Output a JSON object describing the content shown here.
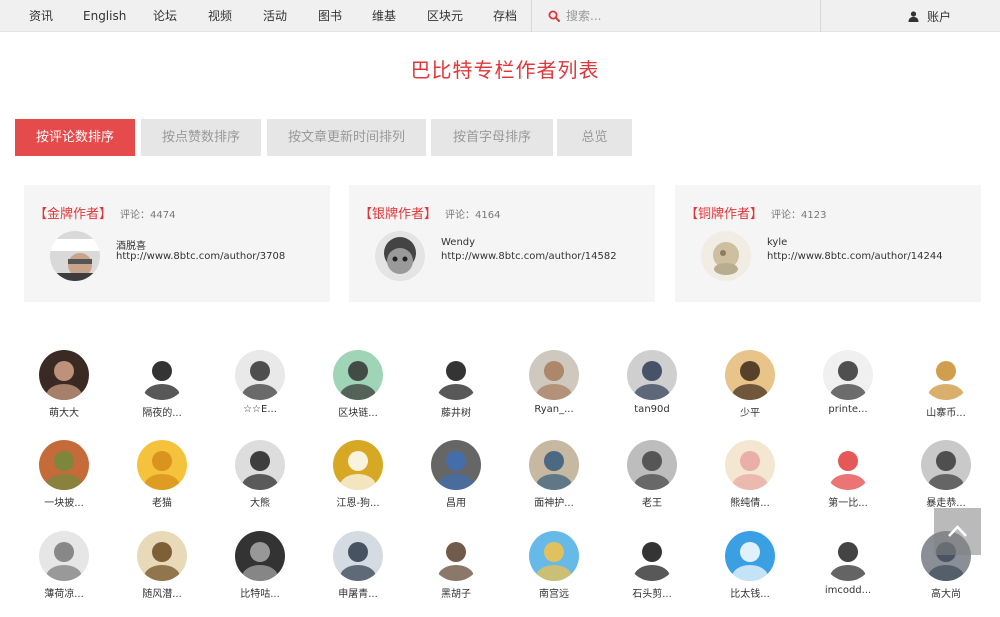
{
  "nav": {
    "items": [
      "资讯",
      "English",
      "论坛",
      "视频",
      "活动",
      "图书",
      "维基",
      "区块元",
      "存档"
    ],
    "search_placeholder": "搜索...",
    "account_label": "账户"
  },
  "page_title": "巴比特专栏作者列表",
  "tabs": [
    "按评论数排序",
    "按点赞数排序",
    "按文章更新时间排列",
    "按首字母排序",
    "总览"
  ],
  "medals": [
    {
      "title": "【金牌作者】",
      "count_label": "评论：4474",
      "name": "酒脱喜",
      "url": "http://www.8btc.com/author/3708"
    },
    {
      "title": "【银牌作者】",
      "count_label": "评论：4164",
      "name": "Wendy",
      "url": "http://www.8btc.com/author/14582"
    },
    {
      "title": "【铜牌作者】",
      "count_label": "评论：4123",
      "name": "kyle",
      "url": "http://www.8btc.com/author/14244"
    }
  ],
  "authors": [
    "萌大大",
    "隔夜的...",
    "☆☆E...",
    "区块链...",
    "藤井树",
    "Ryan_...",
    "tan90d",
    "少平",
    "printe...",
    "山寨币...",
    "一块披...",
    "老猫",
    "大熊",
    "江恩-狗...",
    "昌用",
    "面神护...",
    "老王",
    "熊纯倩...",
    "第一比...",
    "暴走恭...",
    "薄荷凉...",
    "随风潜...",
    "比特咕...",
    "申屠青...",
    "黑胡子",
    "南宫远",
    "石头剪...",
    "比太钱...",
    "imcodd...",
    "高大尚"
  ],
  "colors": {
    "accent": "#e0373a",
    "tab_active": "#e54b4b",
    "tab_inactive": "#e6e6e6"
  }
}
